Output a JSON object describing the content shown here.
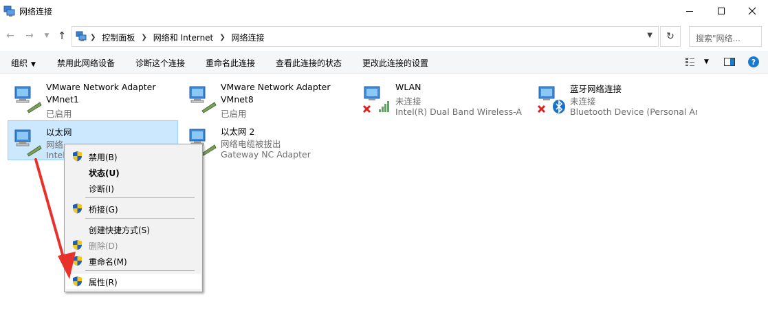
{
  "window": {
    "title": "网络连接"
  },
  "address": {
    "crumbs": [
      "控制面板",
      "网络和 Internet",
      "网络连接"
    ],
    "search_placeholder": "搜索\"网络..."
  },
  "commands": {
    "organize": "组织",
    "disable": "禁用此网络设备",
    "diagnose": "诊断这个连接",
    "rename": "重命名此连接",
    "view_status": "查看此连接的状态",
    "change_settings": "更改此连接的设置"
  },
  "connections": [
    {
      "name": "VMware Network Adapter",
      "line2": "VMnet1",
      "status": "已启用"
    },
    {
      "name": "VMware Network Adapter",
      "line2": "VMnet8",
      "status": "已启用"
    },
    {
      "name": "WLAN",
      "status": "未连接",
      "device": "Intel(R) Dual Band Wireless-A..."
    },
    {
      "name": "蓝牙网络连接",
      "status": "未连接",
      "device": "Bluetooth Device (Personal Ar..."
    },
    {
      "name": "以太网",
      "status": "网络",
      "device": "Intel"
    },
    {
      "name": "以太网 2",
      "status": "网络电缆被拔出",
      "device": "Gateway NC Adapter"
    }
  ],
  "context_menu": {
    "disable": "禁用(B)",
    "status": "状态(U)",
    "diagnose": "诊断(I)",
    "bridge": "桥接(G)",
    "shortcut": "创建快捷方式(S)",
    "delete": "删除(D)",
    "rename": "重命名(M)",
    "properties": "属性(R)"
  },
  "colors": {
    "selection": "#cce8ff",
    "arrow": "#e8312b",
    "accent": "#1979ca"
  }
}
